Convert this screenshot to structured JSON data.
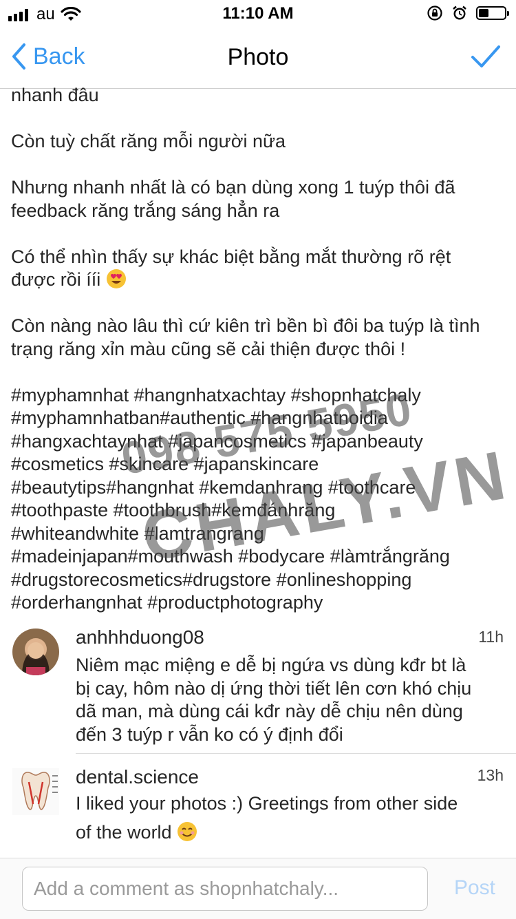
{
  "status_bar": {
    "carrier": "au",
    "time": "11:10 AM",
    "icons": [
      "signal-icon",
      "wifi-icon",
      "rotation-lock-icon",
      "alarm-icon",
      "battery-icon"
    ]
  },
  "nav": {
    "back_label": "Back",
    "title": "Photo",
    "done_icon": "checkmark-icon"
  },
  "caption": {
    "p1": "nhanh đâu",
    "p2": "Còn tuỳ chất răng mỗi người nữa",
    "p3": "Nhưng nhanh nhất là có bạn dùng xong 1 tuýp thôi đã feedback răng trắng sáng hẳn ra",
    "p4": "Có thể nhìn thấy sự khác biệt bằng mắt thường rõ rệt được rồi ííi",
    "p5": "Còn nàng nào lâu thì cứ kiên trì bền bì đôi ba tuýp là tình trạng răng xỉn màu cũng sẽ cải thiện được thôi !",
    "hashtags": [
      "#myphamnhat #hangnhatxachtay #shopnhatchaly",
      "#myphamnhatban#authentic #hangnhatnoidia",
      "#hangxachtaynhat #japancosmetics #japanbeauty",
      "#cosmetics #skincare #japanskincare",
      "#beautytips#hangnhat #kemdanhrang #toothcare",
      "#toothpaste #toothbrush#kemđánhrăng",
      "#whiteandwhite #lamtrangrang",
      "#madeinjapan#mouthwash #bodycare #làmtrắngrăng",
      "#drugstorecosmetics#drugstore #onlineshopping",
      "#orderhangnhat #productphotography"
    ]
  },
  "watermark": {
    "phone": "098 575 5950",
    "site": "CHALY.VN"
  },
  "comments": [
    {
      "username": "anhhhduong08",
      "time": "11h",
      "lines": [
        "Niêm mạc miệng e dễ bị ngứa vs dùng kđr bt là",
        "bị cay, hôm nào dị ứng thời tiết lên cơn khó chịu",
        "dã man, mà dùng cái kđr này dễ chịu nên dùng",
        "đến 3 tuýp r vẫn ko có ý định đổi"
      ]
    },
    {
      "username": "dental.science",
      "time": "13h",
      "lines": [
        "I liked your photos :) Greetings from other side",
        "of the world"
      ]
    }
  ],
  "composer": {
    "placeholder": "Add a comment as shopnhatchaly...",
    "post_label": "Post"
  },
  "colors": {
    "accent": "#3897f0",
    "post_disabled": "#b5d5f7",
    "text": "#262626"
  }
}
